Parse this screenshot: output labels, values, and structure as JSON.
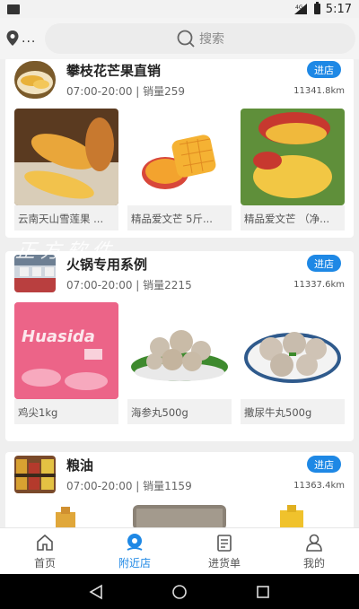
{
  "status_bar": {
    "time": "5:17"
  },
  "header": {
    "location_text": "...",
    "search_placeholder": "搜索"
  },
  "watermark": "正方软件",
  "shops": [
    {
      "name": "攀枝花芒果直销",
      "meta": "07:00-20:00 | 销量259",
      "distance": "11341.8km",
      "enter_label": "进店",
      "products": [
        {
          "name": "云南天山雪莲果 ..."
        },
        {
          "name": "精品爱文芒 5斤..."
        },
        {
          "name": "精品爱文芒 （净..."
        }
      ]
    },
    {
      "name": "火锅专用系例",
      "meta": "07:00-20:00 | 销量2215",
      "distance": "11337.6km",
      "enter_label": "进店",
      "products": [
        {
          "name": "鸡尖1kg"
        },
        {
          "name": "海参丸500g"
        },
        {
          "name": "撒尿牛丸500g"
        }
      ]
    },
    {
      "name": "粮油",
      "meta": "07:00-20:00 | 销量1159",
      "distance": "11363.4km",
      "enter_label": "进店",
      "products": []
    }
  ],
  "tabs": [
    {
      "label": "首页",
      "icon": "home-icon"
    },
    {
      "label": "附近店",
      "icon": "location-pin-icon",
      "active": true
    },
    {
      "label": "进货单",
      "icon": "clipboard-icon"
    },
    {
      "label": "我的",
      "icon": "user-icon"
    }
  ],
  "colors": {
    "accent": "#1e88e5"
  }
}
